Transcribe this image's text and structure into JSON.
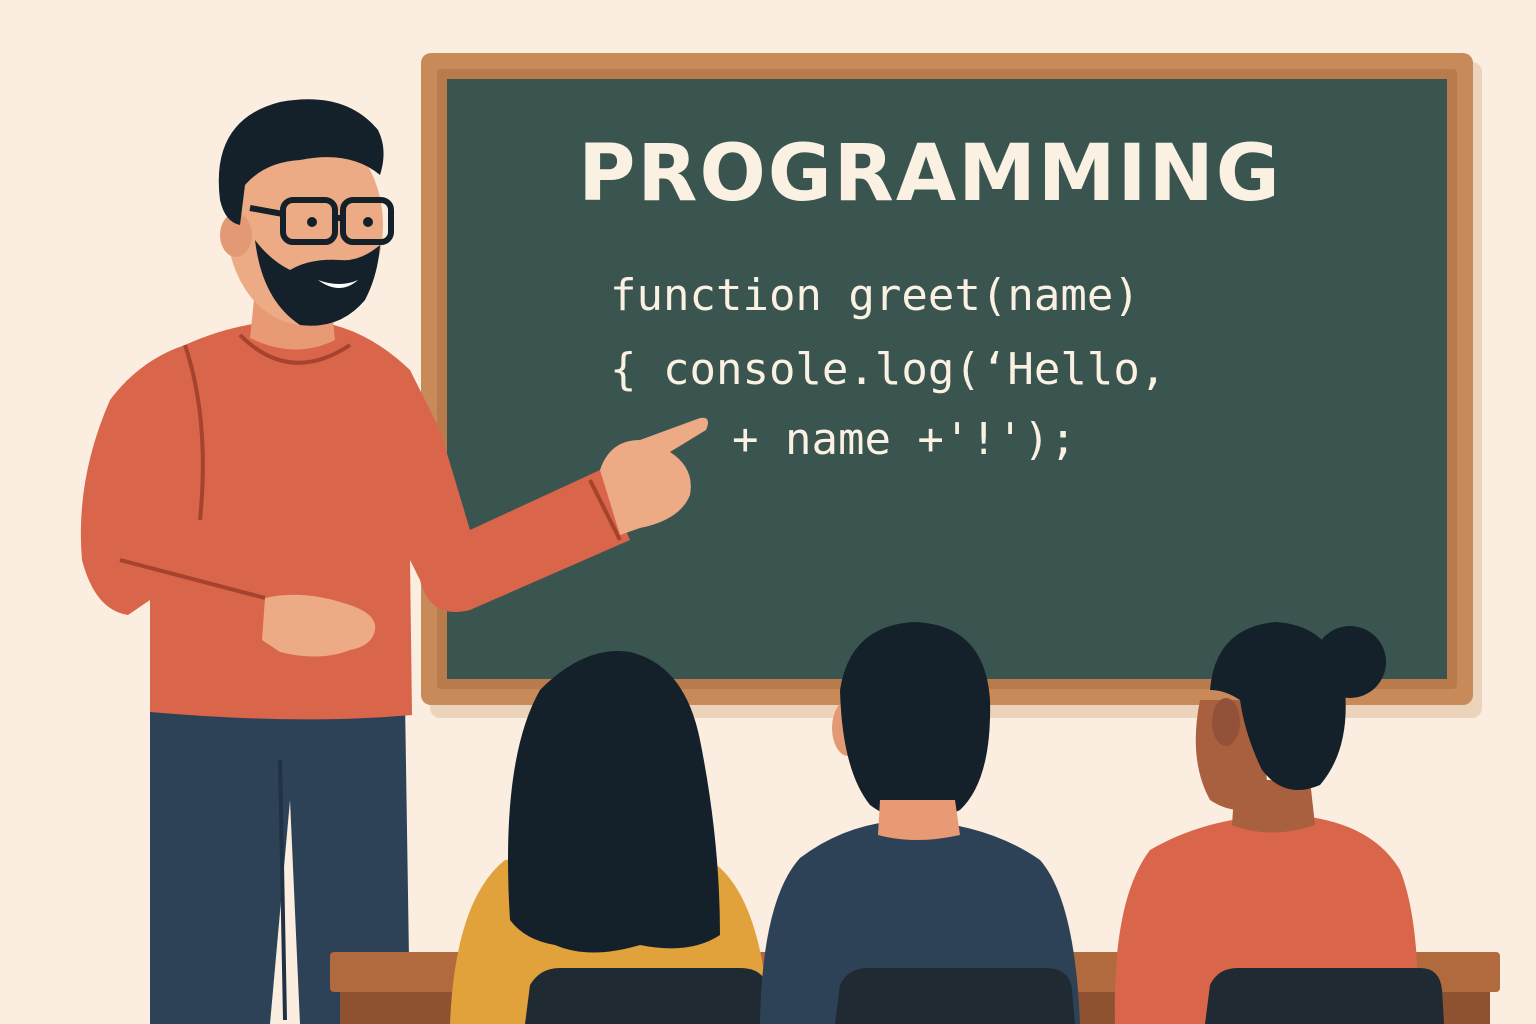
{
  "chalkboard": {
    "title": "PROGRAMMING",
    "code_lines": [
      "function greet(name)",
      "{  console.log(‘Hello,",
      "+ name +'!');"
    ]
  },
  "colors": {
    "background": "#fbeee0",
    "board_frame": "#c98a5a",
    "board_surface": "#3a5550",
    "chalk": "#fbf1e2",
    "teacher_sweater": "#d9654a",
    "teacher_pants": "#2d4257",
    "hair": "#14212b",
    "student_yellow_shirt": "#e1a23c",
    "student_navy_shirt": "#2d4257",
    "student_orange_shirt": "#d9654a",
    "desk": "#b06a3e",
    "chair": "#1f2a33"
  }
}
